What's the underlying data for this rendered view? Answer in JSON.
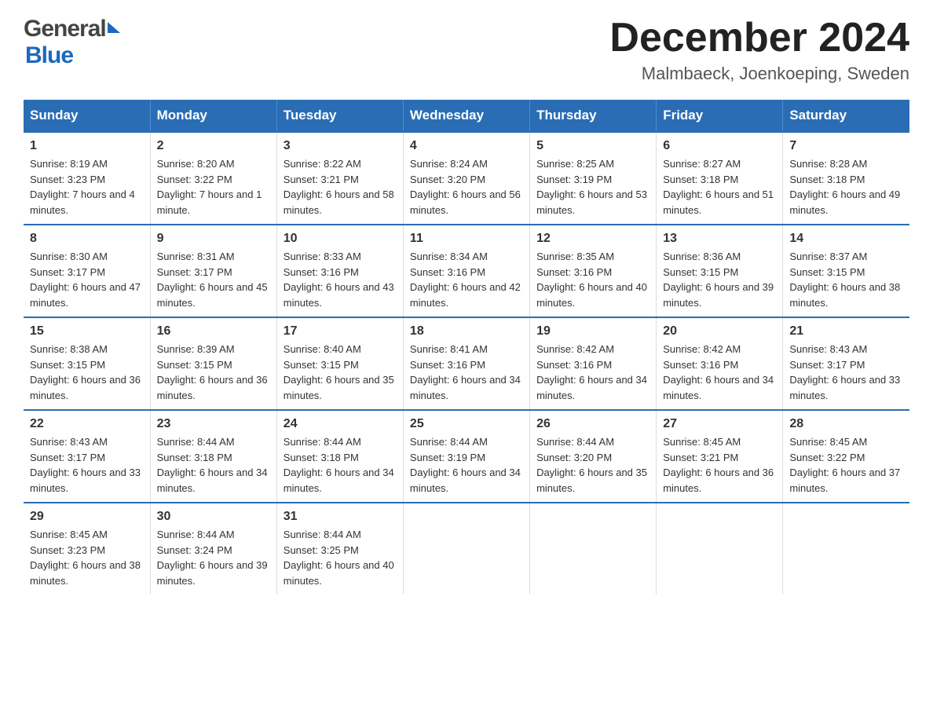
{
  "header": {
    "logo_general": "General",
    "logo_blue": "Blue",
    "month_title": "December 2024",
    "location": "Malmbaeck, Joenkoeping, Sweden"
  },
  "weekdays": [
    "Sunday",
    "Monday",
    "Tuesday",
    "Wednesday",
    "Thursday",
    "Friday",
    "Saturday"
  ],
  "weeks": [
    [
      {
        "day": "1",
        "sunrise": "Sunrise: 8:19 AM",
        "sunset": "Sunset: 3:23 PM",
        "daylight": "Daylight: 7 hours and 4 minutes."
      },
      {
        "day": "2",
        "sunrise": "Sunrise: 8:20 AM",
        "sunset": "Sunset: 3:22 PM",
        "daylight": "Daylight: 7 hours and 1 minute."
      },
      {
        "day": "3",
        "sunrise": "Sunrise: 8:22 AM",
        "sunset": "Sunset: 3:21 PM",
        "daylight": "Daylight: 6 hours and 58 minutes."
      },
      {
        "day": "4",
        "sunrise": "Sunrise: 8:24 AM",
        "sunset": "Sunset: 3:20 PM",
        "daylight": "Daylight: 6 hours and 56 minutes."
      },
      {
        "day": "5",
        "sunrise": "Sunrise: 8:25 AM",
        "sunset": "Sunset: 3:19 PM",
        "daylight": "Daylight: 6 hours and 53 minutes."
      },
      {
        "day": "6",
        "sunrise": "Sunrise: 8:27 AM",
        "sunset": "Sunset: 3:18 PM",
        "daylight": "Daylight: 6 hours and 51 minutes."
      },
      {
        "day": "7",
        "sunrise": "Sunrise: 8:28 AM",
        "sunset": "Sunset: 3:18 PM",
        "daylight": "Daylight: 6 hours and 49 minutes."
      }
    ],
    [
      {
        "day": "8",
        "sunrise": "Sunrise: 8:30 AM",
        "sunset": "Sunset: 3:17 PM",
        "daylight": "Daylight: 6 hours and 47 minutes."
      },
      {
        "day": "9",
        "sunrise": "Sunrise: 8:31 AM",
        "sunset": "Sunset: 3:17 PM",
        "daylight": "Daylight: 6 hours and 45 minutes."
      },
      {
        "day": "10",
        "sunrise": "Sunrise: 8:33 AM",
        "sunset": "Sunset: 3:16 PM",
        "daylight": "Daylight: 6 hours and 43 minutes."
      },
      {
        "day": "11",
        "sunrise": "Sunrise: 8:34 AM",
        "sunset": "Sunset: 3:16 PM",
        "daylight": "Daylight: 6 hours and 42 minutes."
      },
      {
        "day": "12",
        "sunrise": "Sunrise: 8:35 AM",
        "sunset": "Sunset: 3:16 PM",
        "daylight": "Daylight: 6 hours and 40 minutes."
      },
      {
        "day": "13",
        "sunrise": "Sunrise: 8:36 AM",
        "sunset": "Sunset: 3:15 PM",
        "daylight": "Daylight: 6 hours and 39 minutes."
      },
      {
        "day": "14",
        "sunrise": "Sunrise: 8:37 AM",
        "sunset": "Sunset: 3:15 PM",
        "daylight": "Daylight: 6 hours and 38 minutes."
      }
    ],
    [
      {
        "day": "15",
        "sunrise": "Sunrise: 8:38 AM",
        "sunset": "Sunset: 3:15 PM",
        "daylight": "Daylight: 6 hours and 36 minutes."
      },
      {
        "day": "16",
        "sunrise": "Sunrise: 8:39 AM",
        "sunset": "Sunset: 3:15 PM",
        "daylight": "Daylight: 6 hours and 36 minutes."
      },
      {
        "day": "17",
        "sunrise": "Sunrise: 8:40 AM",
        "sunset": "Sunset: 3:15 PM",
        "daylight": "Daylight: 6 hours and 35 minutes."
      },
      {
        "day": "18",
        "sunrise": "Sunrise: 8:41 AM",
        "sunset": "Sunset: 3:16 PM",
        "daylight": "Daylight: 6 hours and 34 minutes."
      },
      {
        "day": "19",
        "sunrise": "Sunrise: 8:42 AM",
        "sunset": "Sunset: 3:16 PM",
        "daylight": "Daylight: 6 hours and 34 minutes."
      },
      {
        "day": "20",
        "sunrise": "Sunrise: 8:42 AM",
        "sunset": "Sunset: 3:16 PM",
        "daylight": "Daylight: 6 hours and 34 minutes."
      },
      {
        "day": "21",
        "sunrise": "Sunrise: 8:43 AM",
        "sunset": "Sunset: 3:17 PM",
        "daylight": "Daylight: 6 hours and 33 minutes."
      }
    ],
    [
      {
        "day": "22",
        "sunrise": "Sunrise: 8:43 AM",
        "sunset": "Sunset: 3:17 PM",
        "daylight": "Daylight: 6 hours and 33 minutes."
      },
      {
        "day": "23",
        "sunrise": "Sunrise: 8:44 AM",
        "sunset": "Sunset: 3:18 PM",
        "daylight": "Daylight: 6 hours and 34 minutes."
      },
      {
        "day": "24",
        "sunrise": "Sunrise: 8:44 AM",
        "sunset": "Sunset: 3:18 PM",
        "daylight": "Daylight: 6 hours and 34 minutes."
      },
      {
        "day": "25",
        "sunrise": "Sunrise: 8:44 AM",
        "sunset": "Sunset: 3:19 PM",
        "daylight": "Daylight: 6 hours and 34 minutes."
      },
      {
        "day": "26",
        "sunrise": "Sunrise: 8:44 AM",
        "sunset": "Sunset: 3:20 PM",
        "daylight": "Daylight: 6 hours and 35 minutes."
      },
      {
        "day": "27",
        "sunrise": "Sunrise: 8:45 AM",
        "sunset": "Sunset: 3:21 PM",
        "daylight": "Daylight: 6 hours and 36 minutes."
      },
      {
        "day": "28",
        "sunrise": "Sunrise: 8:45 AM",
        "sunset": "Sunset: 3:22 PM",
        "daylight": "Daylight: 6 hours and 37 minutes."
      }
    ],
    [
      {
        "day": "29",
        "sunrise": "Sunrise: 8:45 AM",
        "sunset": "Sunset: 3:23 PM",
        "daylight": "Daylight: 6 hours and 38 minutes."
      },
      {
        "day": "30",
        "sunrise": "Sunrise: 8:44 AM",
        "sunset": "Sunset: 3:24 PM",
        "daylight": "Daylight: 6 hours and 39 minutes."
      },
      {
        "day": "31",
        "sunrise": "Sunrise: 8:44 AM",
        "sunset": "Sunset: 3:25 PM",
        "daylight": "Daylight: 6 hours and 40 minutes."
      },
      null,
      null,
      null,
      null
    ]
  ]
}
